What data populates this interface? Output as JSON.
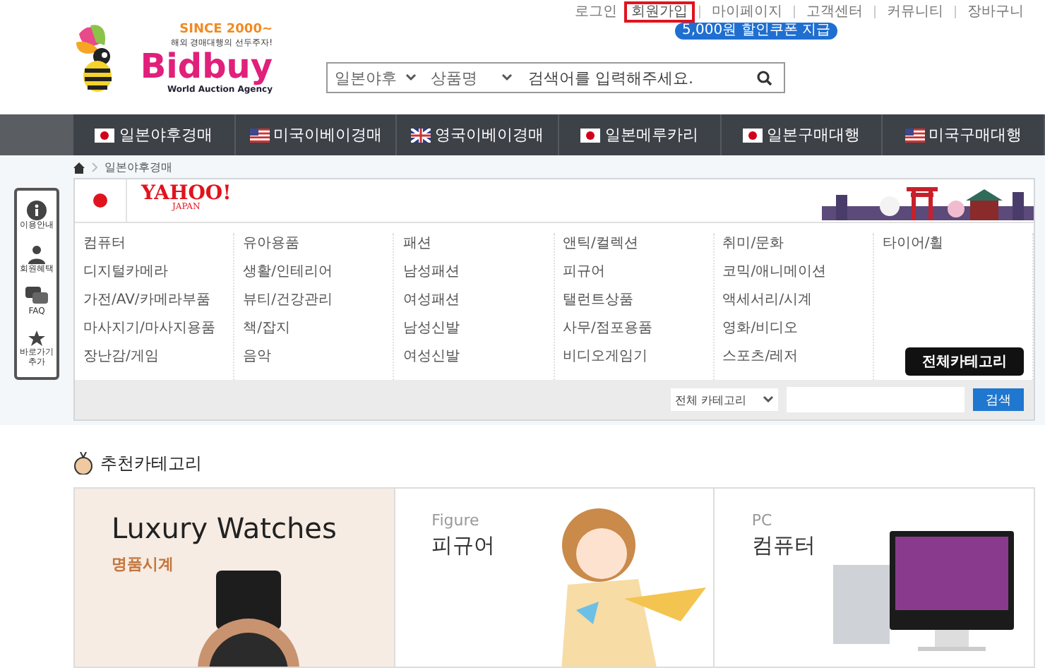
{
  "top_links": [
    {
      "label": "로그인",
      "highlighted": false
    },
    {
      "label": "회원가입",
      "highlighted": true
    },
    {
      "label": "마이페이지",
      "highlighted": false
    },
    {
      "label": "고객센터",
      "highlighted": false
    },
    {
      "label": "커뮤니티",
      "highlighted": false
    },
    {
      "label": "장바구니",
      "highlighted": false
    }
  ],
  "coupon_badge": "5,000원 할인쿠폰 지급",
  "logo": {
    "since": "SINCE 2000~",
    "slogan": "해외 경매대행의 선두주자!",
    "name": "Bidbuy",
    "tagline": "World Auction Agency"
  },
  "search": {
    "site": "일본야후",
    "field": "상품명",
    "placeholder": "검색어를 입력해주세요."
  },
  "nav": [
    {
      "label": "일본야후경매",
      "kind": "jp"
    },
    {
      "label": "미국이베이경매",
      "kind": "us"
    },
    {
      "label": "영국이베이경매",
      "kind": "uk"
    },
    {
      "label": "일본메루카리",
      "kind": "jp"
    },
    {
      "label": "일본구매대행",
      "kind": "jp"
    },
    {
      "label": "미국구매대행",
      "kind": "us"
    }
  ],
  "breadcrumb": "일본야후경매",
  "quick_menu": [
    {
      "label": "이용안내",
      "kind": "info"
    },
    {
      "label": "회원혜택",
      "kind": "member"
    },
    {
      "label": "FAQ",
      "kind": "faq"
    },
    {
      "label": "바로가기 추가",
      "kind": "star"
    }
  ],
  "yahoo": {
    "brand": "YAHOO!",
    "region": "JAPAN"
  },
  "categories": [
    [
      "컴퓨터",
      "디지털카메라",
      "가전/AV/카메라부품",
      "마사지기/마사지용품",
      "장난감/게임"
    ],
    [
      "유아용품",
      "생활/인테리어",
      "뷰티/건강관리",
      "책/잡지",
      "음악"
    ],
    [
      "패션",
      "남성패션",
      "여성패션",
      "남성신발",
      "여성신발"
    ],
    [
      "앤틱/컬렉션",
      "피규어",
      "탤런트상품",
      "사무/점포용품",
      "비디오게임기"
    ],
    [
      "취미/문화",
      "코믹/애니메이션",
      "액세서리/시계",
      "영화/비디오",
      "스포츠/레저"
    ],
    [
      "타이어/휠"
    ]
  ],
  "all_categories_button": "전체카테고리",
  "category_search": {
    "select": "전체 카테고리",
    "button": "검색"
  },
  "recommended": {
    "title": "추천카테고리",
    "cards": [
      {
        "kind": "watch",
        "title": "Luxury Watches",
        "subtitle": "명품시계"
      },
      {
        "kind": "figure",
        "title": "Figure",
        "subtitle": "피규어"
      },
      {
        "kind": "pc",
        "title": "PC",
        "subtitle": "컴퓨터"
      }
    ]
  }
}
